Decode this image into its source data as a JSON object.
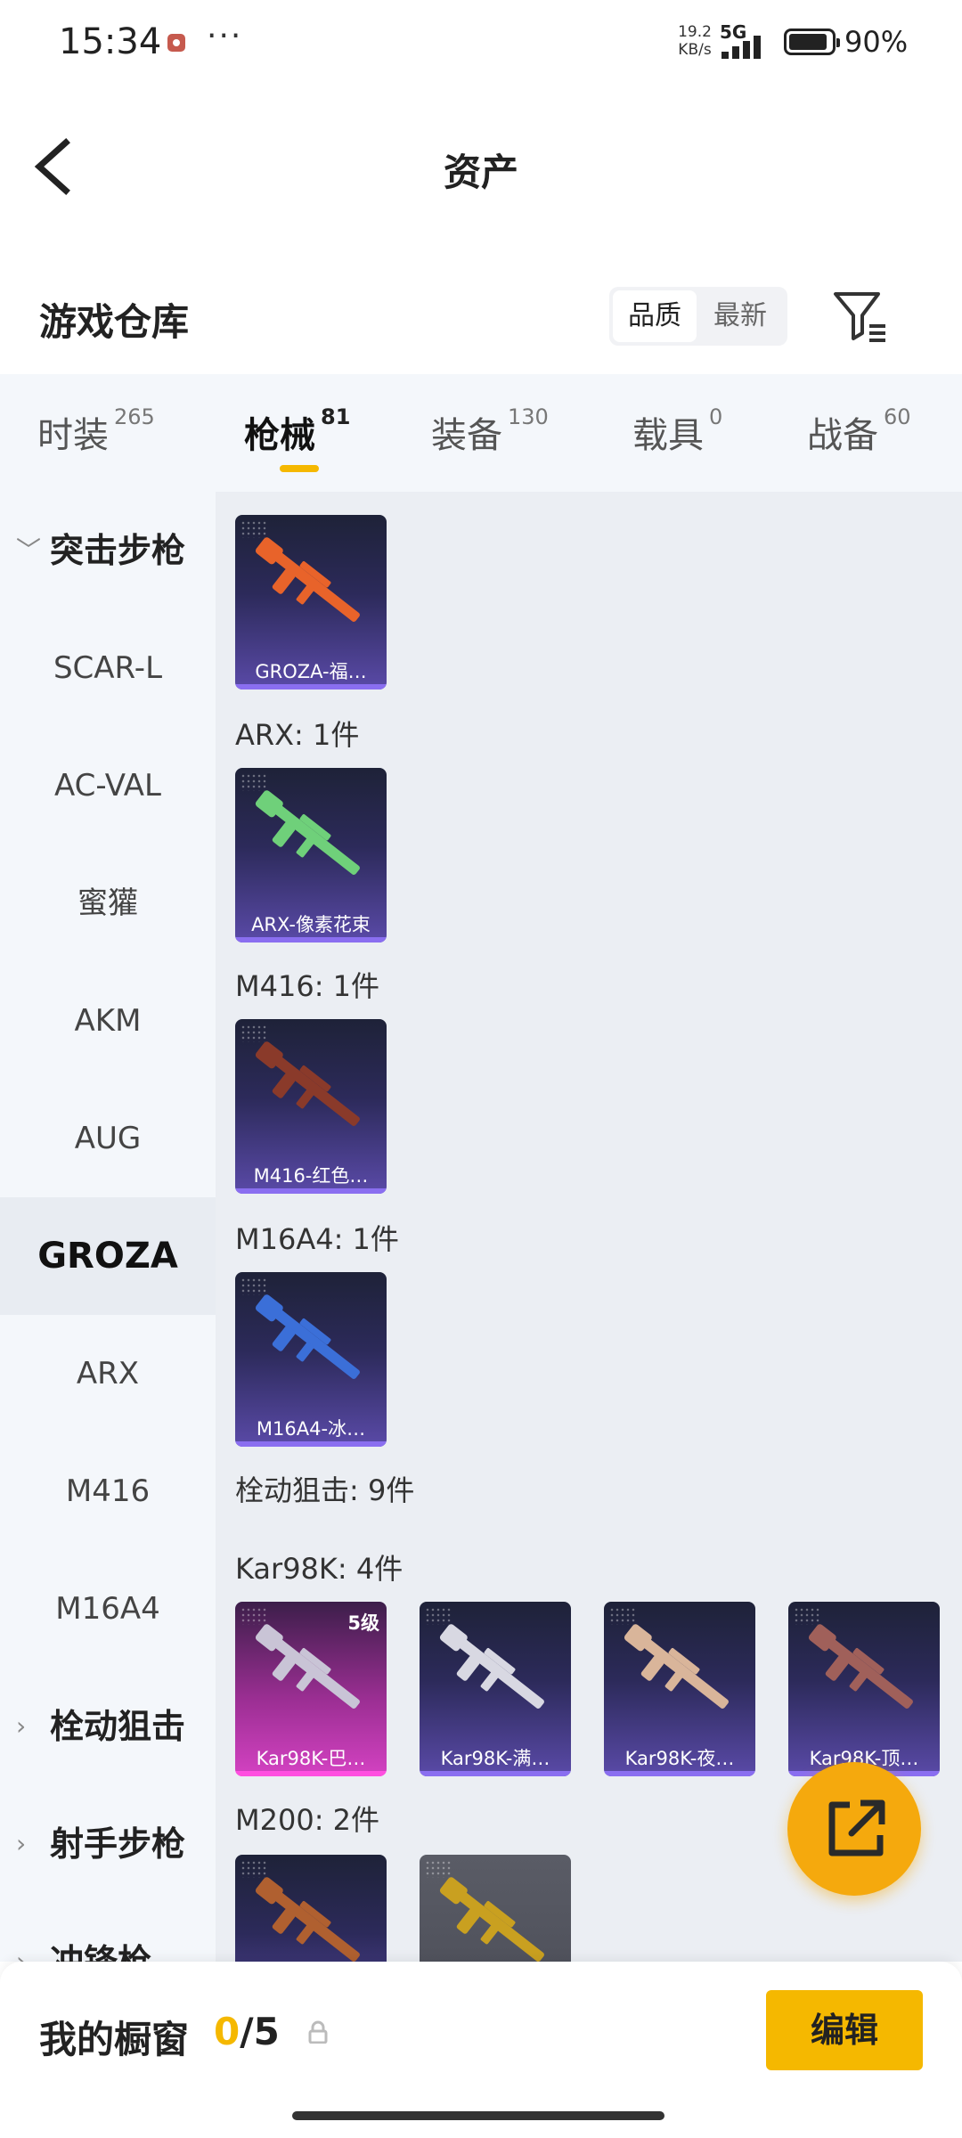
{
  "status_bar": {
    "time": "15:34",
    "more": "···",
    "net_speed": "19.2",
    "net_unit": "KB/s",
    "network": "5G",
    "battery": "90%"
  },
  "header": {
    "title": "资产"
  },
  "warehouse": {
    "title": "游戏仓库",
    "sort_options": [
      "品质",
      "最新"
    ],
    "sort_selected": "品质"
  },
  "tabs": [
    {
      "label": "时装",
      "count": "265"
    },
    {
      "label": "枪械",
      "count": "81",
      "active": true
    },
    {
      "label": "装备",
      "count": "130"
    },
    {
      "label": "载具",
      "count": "0"
    },
    {
      "label": "战备",
      "count": "60"
    }
  ],
  "sidebar": {
    "items": [
      {
        "label": "突击步枪",
        "type": "group",
        "expanded": true
      },
      {
        "label": "SCAR-L"
      },
      {
        "label": "AC-VAL"
      },
      {
        "label": "蜜獾"
      },
      {
        "label": "AKM"
      },
      {
        "label": "AUG"
      },
      {
        "label": "GROZA",
        "selected": true
      },
      {
        "label": "ARX"
      },
      {
        "label": "M416"
      },
      {
        "label": "M16A4"
      },
      {
        "label": "栓动狙击",
        "type": "group"
      },
      {
        "label": "射手步枪",
        "type": "group"
      },
      {
        "label": "冲锋枪",
        "type": "group"
      }
    ]
  },
  "content": {
    "sections": [
      {
        "title": "ARX: 1件"
      },
      {
        "title": "M416: 1件"
      },
      {
        "title": "M16A4: 1件"
      },
      {
        "title": "栓动狙击: 9件"
      },
      {
        "title": "Kar98K: 4件"
      },
      {
        "title": "M200: 2件"
      }
    ],
    "cards": [
      {
        "label": "GROZA-福…",
        "gun_color": "#e8632a"
      },
      {
        "label": "ARX-像素花束",
        "gun_color": "#6fd07a"
      },
      {
        "label": "M416-红色…",
        "gun_color": "#8a3a2a"
      },
      {
        "label": "M16A4-冰…",
        "gun_color": "#3b6fd8"
      },
      {
        "label": "Kar98K-巴…",
        "level": "5级",
        "gun_color": "#c9c4d6"
      },
      {
        "label": "Kar98K-满…",
        "gun_color": "#d8d8e2"
      },
      {
        "label": "Kar98K-夜…",
        "gun_color": "#d9b59a"
      },
      {
        "label": "Kar98K-顶…",
        "gun_color": "#a0605a"
      },
      {
        "label": "",
        "gun_color": "#b06030"
      },
      {
        "label": "",
        "gun_color": "#c9a020"
      }
    ]
  },
  "bottom": {
    "showcase_label": "我的橱窗",
    "count_current": "0",
    "count_sep_total": "/5",
    "edit_label": "编辑"
  },
  "colors": {
    "accent": "#f5b800",
    "fab": "#f5a90d",
    "card_purple": "#5a4aa8",
    "card_pink": "#d442c2"
  }
}
